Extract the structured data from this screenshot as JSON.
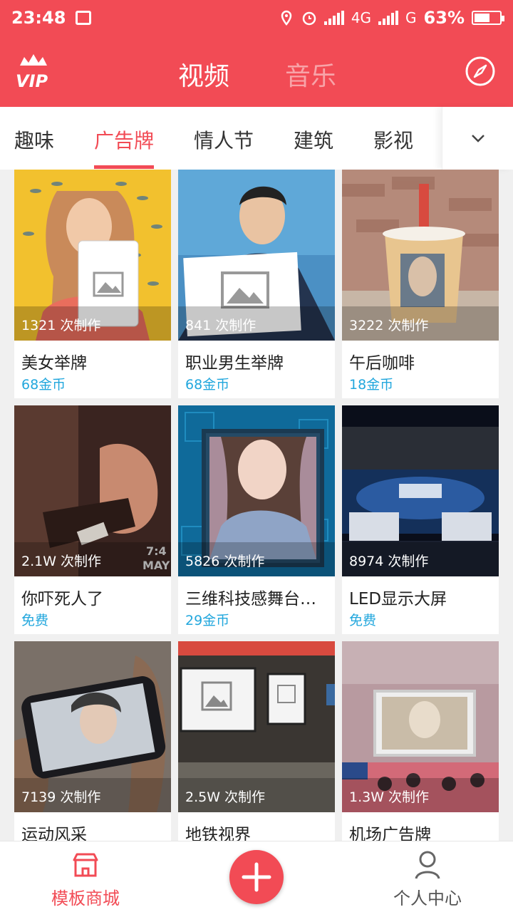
{
  "status_bar": {
    "time": "23:48",
    "network1": "4G",
    "network2": "G",
    "battery": "63%",
    "battery_level": 0.63
  },
  "header": {
    "tab_video": "视频",
    "tab_music": "音乐",
    "vip_label": "VIP",
    "accent": "#f24b55"
  },
  "categories": {
    "items": [
      "趣味",
      "广告牌",
      "情人节",
      "建筑",
      "影视"
    ],
    "active": "广告牌"
  },
  "cards": [
    {
      "count": "1321 次制作",
      "title": "美女举牌",
      "price": "68金币"
    },
    {
      "count": "841 次制作",
      "title": "职业男生举牌",
      "price": "68金币"
    },
    {
      "count": "3222 次制作",
      "title": "午后咖啡",
      "price": "18金币"
    },
    {
      "count": "2.1W  次制作",
      "title": "你吓死人了",
      "price": "免费"
    },
    {
      "count": "5826 次制作",
      "title": "三维科技感舞台…",
      "price": "29金币"
    },
    {
      "count": "8974 次制作",
      "title": "LED显示大屏",
      "price": "免费"
    },
    {
      "count": "7139 次制作",
      "title": "运动风采",
      "price": ""
    },
    {
      "count": "2.5W  次制作",
      "title": "地铁视界",
      "price": ""
    },
    {
      "count": "1.3W  次制作",
      "title": "机场广告牌",
      "price": ""
    }
  ],
  "bottom_nav": {
    "store": "模板商城",
    "profile": "个人中心"
  }
}
